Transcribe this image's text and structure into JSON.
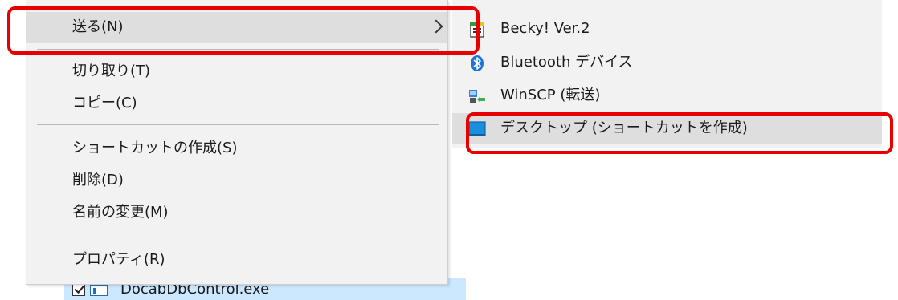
{
  "main_menu": {
    "items": [
      {
        "label": "送る(N)"
      },
      {
        "label": "切り取り(T)"
      },
      {
        "label": "コピー(C)"
      },
      {
        "label": "ショートカットの作成(S)"
      },
      {
        "label": "削除(D)"
      },
      {
        "label": "名前の変更(M)"
      },
      {
        "label": "プロパティ(R)"
      }
    ]
  },
  "send_to_submenu": {
    "items": [
      {
        "label": "Becky! Ver.2",
        "icon": "becky-icon"
      },
      {
        "label": "Bluetooth デバイス",
        "icon": "bluetooth-icon"
      },
      {
        "label": "WinSCP (転送)",
        "icon": "winscp-icon"
      },
      {
        "label": "デスクトップ (ショートカットを作成)",
        "icon": "desktop-icon"
      }
    ]
  },
  "file_row": {
    "name": "DocabDbControl.exe",
    "checked": true
  },
  "colors": {
    "menu_bg": "#f2f2f2",
    "highlight": "#dedede",
    "annotation": "#e60000",
    "selection": "#cce8ff"
  }
}
